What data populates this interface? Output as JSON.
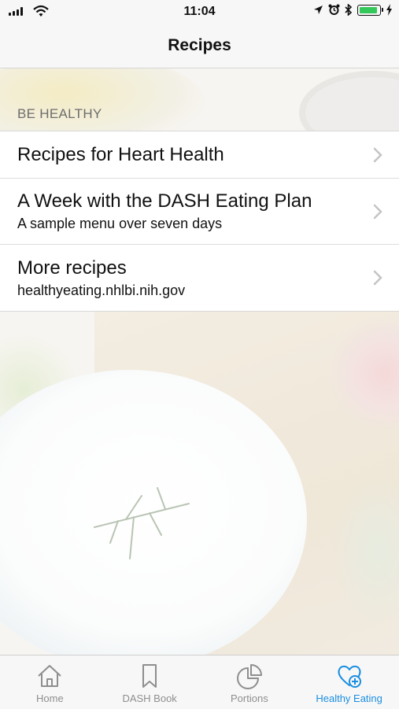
{
  "status_bar": {
    "time": "11:04",
    "icons": [
      "signal-icon",
      "wifi-icon",
      "location-icon",
      "alarm-icon",
      "bluetooth-icon",
      "battery-icon",
      "charging-icon"
    ],
    "battery_level": 0.78,
    "battery_color": "#34c759"
  },
  "nav": {
    "title": "Recipes"
  },
  "section": {
    "header": "BE HEALTHY"
  },
  "rows": [
    {
      "label": "Recipes for Heart Health",
      "subtitle": ""
    },
    {
      "label": "A Week with the DASH Eating Plan",
      "subtitle": "A sample menu over seven days"
    },
    {
      "label": "More recipes",
      "subtitle": "healthyeating.nhlbi.nih.gov"
    }
  ],
  "tabs": [
    {
      "label": "Home",
      "icon": "home-icon",
      "active": false
    },
    {
      "label": "DASH Book",
      "icon": "bookmark-icon",
      "active": false
    },
    {
      "label": "Portions",
      "icon": "pie-chart-icon",
      "active": false
    },
    {
      "label": "Healthy Eating",
      "icon": "heart-plus-icon",
      "active": true
    }
  ],
  "colors": {
    "accent": "#1a8ee0",
    "inactive": "#8e8e8e"
  }
}
